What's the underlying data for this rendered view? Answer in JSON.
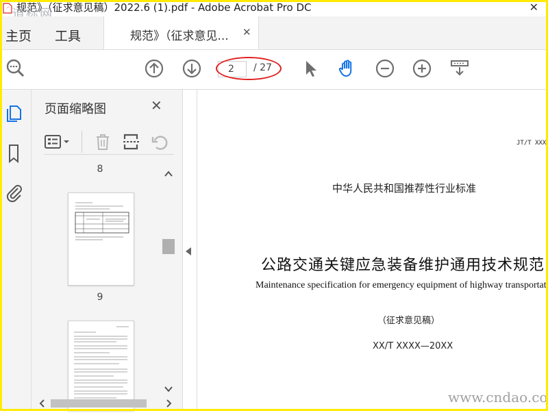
{
  "window": {
    "title": "规范》（征求意见稿）2022.6 (1).pdf - Adobe Acrobat Pro DC",
    "close_glyph": "✕",
    "watermark_left": "道标网"
  },
  "tabs": {
    "home": "主页",
    "tools": "工具",
    "document": "规范》（征求意见...",
    "document_close": "✕"
  },
  "toolbar": {
    "current_page": "2",
    "page_total": "/ 27",
    "icons": [
      "search-icon",
      "page-up-icon",
      "page-down-icon",
      "select-cursor-icon",
      "hand-tool-icon",
      "zoom-out-icon",
      "zoom-in-icon",
      "scroll-mode-icon"
    ],
    "accent_color": "#1473e6",
    "highlight_color": "#e02020"
  },
  "left_rail": {
    "icons": [
      "page-thumbnails-icon",
      "bookmarks-icon",
      "attachments-icon"
    ]
  },
  "thumbnail_panel": {
    "title": "页面缩略图",
    "close": "✕",
    "tools": [
      "thumbnail-options-icon",
      "delete-icon",
      "extract-icon",
      "rotate-icon"
    ],
    "page_numbers": [
      "8",
      "9"
    ]
  },
  "document": {
    "code": "JT/T XXXX",
    "issuer": "中华人民共和国推荐性行业标准",
    "title_cn": "公路交通关键应急装备维护通用技术规范",
    "title_en": "Maintenance specification for emergency equipment of highway transportation",
    "status": "（征求意见稿）",
    "draft_number": "XX/T XXXX—20XX",
    "watermark": "www.cndao.com"
  },
  "colors": {
    "frame": "#ffeb00",
    "toolbar_bg": "#ffffff",
    "panel_bg": "#f4f4f4",
    "icon_gray": "#6e6e6e"
  }
}
